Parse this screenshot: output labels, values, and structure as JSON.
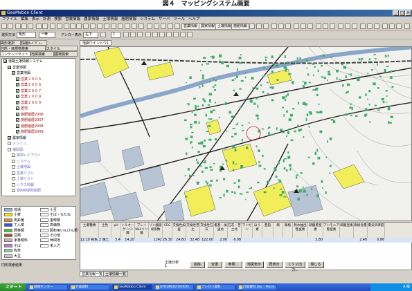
{
  "caption": "図４　マッピングシステム画面",
  "window": {
    "title": "GeoMation Client",
    "menu": [
      "ファイル",
      "編集",
      "表示",
      "計測",
      "検索",
      "営業情報",
      "農家情報",
      "土壌情報",
      "施肥情報",
      "システム",
      "サーバ",
      "ツール",
      "ヘルプ"
    ]
  },
  "toolbar": {
    "btn_sales": "営業情報",
    "btn_farmer": "農家情報",
    "btn_soil": "土壌情報",
    "btn_fertilize": "施肥情報",
    "combo_select_label": "選択方法",
    "combo_select_value": "矩形",
    "combo_field_value": "一筆",
    "anchor_label": "アンカー表示",
    "anchor_value": "右下",
    "scale_value": "1"
  },
  "left_panel": {
    "tabs_row1": [
      "図形選択",
      "情報ｶｰﾄﾞﾋﾞｭｰ"
    ],
    "tabs_row2": [
      "住所・目標物検索",
      "スタイル"
    ],
    "tabs_row3": [
      "コンテンツセット",
      "地図検索",
      "圃場検索"
    ],
    "tree": [
      {
        "label": "道路土壌情報システム",
        "level": 0,
        "checked": true
      },
      {
        "label": "営業地図",
        "level": 1,
        "checked": true
      },
      {
        "label": "営業地図",
        "level": 2,
        "checked": true
      },
      {
        "label": "営業２００５",
        "level": 3,
        "checked": true
      },
      {
        "label": "営業２００６",
        "level": 3,
        "checked": true
      },
      {
        "label": "営業２００７",
        "level": 3,
        "checked": true
      },
      {
        "label": "営業２００８",
        "level": 3,
        "checked": true
      },
      {
        "label": "営業２００９",
        "level": 3,
        "checked": true
      },
      {
        "label": "農地",
        "level": 3,
        "checked": true
      },
      {
        "label": "施肥履歴2006",
        "level": 3,
        "checked": true
      },
      {
        "label": "施肥履歴2007",
        "level": 3,
        "checked": true
      },
      {
        "label": "施肥履歴2008",
        "level": 3,
        "checked": true
      },
      {
        "label": "施肥履歴2009",
        "level": 3,
        "checked": true
      },
      {
        "label": "農家情報",
        "level": 1,
        "checked": true
      },
      {
        "label": "メッシュ",
        "level": 1,
        "checked": false
      },
      {
        "label": "補助図",
        "level": 1,
        "checked": false
      },
      {
        "label": "図郭レイアウト",
        "level": 2,
        "checked": false
      },
      {
        "label": "システム",
        "level": 2,
        "checked": false
      },
      {
        "label": "土壌地図",
        "level": 2,
        "checked": false
      },
      {
        "label": "営業リスト",
        "level": 2,
        "checked": false
      },
      {
        "label": "土壌リスト",
        "level": 2,
        "checked": false
      },
      {
        "label": "ハウス情報",
        "level": 2,
        "checked": false
      },
      {
        "label": "使用時期別施肥",
        "level": 2,
        "checked": false
      }
    ],
    "legend": [
      {
        "label": "普通",
        "color": "#8fb4e0"
      },
      {
        "label": "小麦",
        "color": "#f4f000"
      },
      {
        "label": "馬鈴薯",
        "color": "#e58a2a"
      },
      {
        "label": "てん菜",
        "color": "#3a4fe0"
      },
      {
        "label": "野菜類",
        "color": "#50c050"
      },
      {
        "label": "豆類",
        "color": "#a05a20"
      },
      {
        "label": "家畜飼料",
        "color": "#e0a0c0"
      },
      {
        "label": "そば",
        "color": "#c07ad0"
      },
      {
        "label": "牧草",
        "color": "#90d0a0"
      },
      {
        "label": "大豆",
        "color": "#c8c8c8"
      },
      {
        "label": "小豆",
        "color": "#ffffff"
      },
      {
        "label": "そば・なたね",
        "color": "#ffffff"
      },
      {
        "label": "金時類",
        "color": "#ffffff"
      },
      {
        "label": "高価物",
        "color": "#ffffff"
      },
      {
        "label": "飼料用いんげん類",
        "color": "#ffffff"
      },
      {
        "label": "その他",
        "color": "#ffffff"
      },
      {
        "label": "休閑地",
        "color": "#ffffff"
      },
      {
        "label": "未入力",
        "color": "#ffffff"
      }
    ],
    "status": "円形検索結果"
  },
  "map": {
    "tab": "地図ウインドウ1",
    "highlight_color": "#f2ee5a",
    "road_color": "#222222",
    "building_color": "#3fae6a"
  },
  "table": {
    "headers": [
      "土壌種類",
      "土性",
      "pH",
      "トルオーグ-リン酸",
      "ブレイNo2リン酸",
      "リン酸吸収係数",
      "CEC",
      "交換性加里",
      "交換性苦土",
      "交換性石灰",
      "塩基・加里比",
      "石灰・苦土比",
      "マンガン",
      "ほう素",
      "亜鉛",
      "銅",
      "腐植",
      "熱水抽出性窒素",
      "硝酸態窒素",
      "アンモニア態窒素",
      "硝酸窒素",
      "腐植含量",
      "電気伝導度"
    ],
    "row": [
      "12:10 褐色…",
      "2 壌土",
      "5.4",
      "14.20",
      "",
      "1242",
      "26.30",
      "24.60",
      "32.48",
      "122.00",
      "2.06",
      "6.08",
      "",
      "",
      "",
      "",
      "",
      "",
      "2.80",
      "",
      "",
      "2.48",
      "0.86"
    ],
    "result_label": "土壌分析:",
    "result_count": "1",
    "buttons": [
      "削除",
      "全選",
      "参照...",
      "地図表示",
      "再表示",
      "ＣＳＶ出力...",
      "閉じる"
    ]
  },
  "bottom_tabs": [
    "営業情報一覧",
    "土壌情報一覧"
  ],
  "taskbar": {
    "start": "スタート",
    "tasks": [
      "調査センター",
      "計画資料",
      "GeoMation Client",
      "GYOUMUKYOURYO",
      "プレゼン資料",
      "計画資料.doc - Micro..."
    ],
    "tray": "A 般"
  }
}
